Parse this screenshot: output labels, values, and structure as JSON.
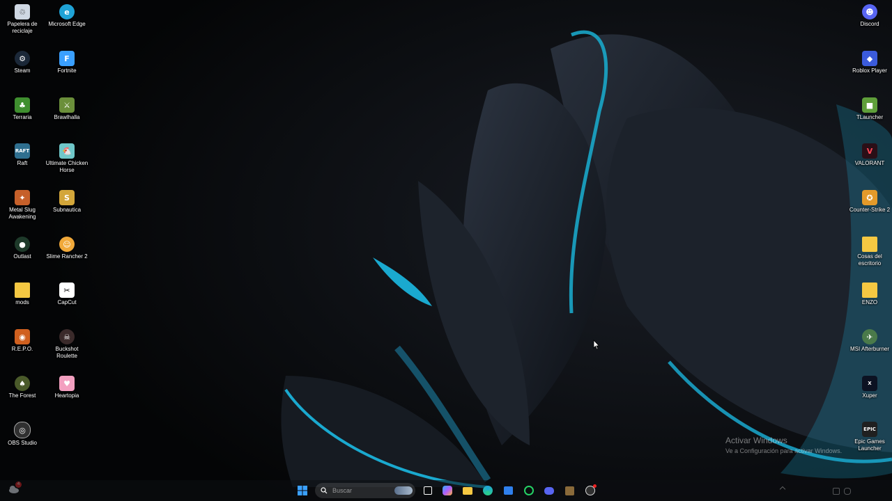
{
  "desktop": {
    "left_icons": [
      {
        "label": "Papelera de reciclaje",
        "icon": "recycle-bin-icon",
        "color": "#cfd8e3"
      },
      {
        "label": "Microsoft Edge",
        "icon": "edge-icon",
        "color": "#1fa3d6"
      },
      {
        "label": "Steam",
        "icon": "steam-icon",
        "color": "#1b2838"
      },
      {
        "label": "Fortnite",
        "icon": "fortnite-icon",
        "color": "#3aa0ff"
      },
      {
        "label": "Terraria",
        "icon": "terraria-icon",
        "color": "#3f8f2f"
      },
      {
        "label": "Brawlhalla",
        "icon": "brawlhalla-icon",
        "color": "#6b8f3a"
      },
      {
        "label": "Raft",
        "icon": "raft-icon",
        "color": "#2f6f8f"
      },
      {
        "label": "Ultimate Chicken Horse",
        "icon": "chicken-horse-icon",
        "color": "#6fc7c9"
      },
      {
        "label": "Metal Slug Awakening",
        "icon": "metal-slug-icon",
        "color": "#c6602a"
      },
      {
        "label": "Subnautica",
        "icon": "subnautica-icon",
        "color": "#d3a63a"
      },
      {
        "label": "Outlast",
        "icon": "outlast-icon",
        "color": "#1e3a2a"
      },
      {
        "label": "Slime Rancher 2",
        "icon": "slime-rancher-icon",
        "color": "#f1a93a"
      },
      {
        "label": "mods",
        "icon": "folder-icon",
        "color": "#f5c842"
      },
      {
        "label": "CapCut",
        "icon": "capcut-icon",
        "color": "#ffffff"
      },
      {
        "label": "R.E.P.O.",
        "icon": "repo-icon",
        "color": "#d0601f"
      },
      {
        "label": "Buckshot Roulette",
        "icon": "buckshot-roulette-icon",
        "color": "#3a2a2a"
      },
      {
        "label": "The Forest",
        "icon": "the-forest-icon",
        "color": "#4a5a2a"
      },
      {
        "label": "Heartopia",
        "icon": "heartopia-icon",
        "color": "#f3a0c0"
      },
      {
        "label": "OBS Studio",
        "icon": "obs-icon",
        "color": "#303030"
      }
    ],
    "right_icons": [
      {
        "label": "Discord",
        "icon": "discord-icon",
        "color": "#5865f2"
      },
      {
        "label": "Roblox Player",
        "icon": "roblox-icon",
        "color": "#3b5bdb"
      },
      {
        "label": "TLauncher",
        "icon": "tlauncher-icon",
        "color": "#5f9f3a"
      },
      {
        "label": "VALORANT",
        "icon": "valorant-icon",
        "color": "#2a0f17"
      },
      {
        "label": "Counter-Strike 2",
        "icon": "counter-strike-icon",
        "color": "#e39a2a"
      },
      {
        "label": "Cosas del escritorio",
        "icon": "folder-icon",
        "color": "#f5c842"
      },
      {
        "label": "ENZO",
        "icon": "folder-icon",
        "color": "#f5c842"
      },
      {
        "label": "MSI Afterburner",
        "icon": "msi-afterburner-icon",
        "color": "#4a7a4a"
      },
      {
        "label": "Xuper",
        "icon": "xuper-icon",
        "color": "#0c1222"
      },
      {
        "label": "Epic Games Launcher",
        "icon": "epic-games-icon",
        "color": "#202020"
      }
    ]
  },
  "watermark": {
    "line1": "Activar Windows",
    "line2": "Ve a Configuración para activar Windows."
  },
  "taskbar": {
    "search_placeholder": "Buscar",
    "widgets_badge": "4",
    "apps": [
      {
        "icon": "start-icon",
        "color": "#3aa0ff"
      },
      {
        "icon": "task-view-icon",
        "color": "#ffffff"
      },
      {
        "icon": "copilot-icon",
        "color": "#6ad0ff"
      },
      {
        "icon": "file-explorer-icon",
        "color": "#f5c842"
      },
      {
        "icon": "edge-icon",
        "color": "#1fa3d6"
      },
      {
        "icon": "microsoft-store-icon",
        "color": "#2f80ed"
      },
      {
        "icon": "whatsapp-icon",
        "color": "#25d366"
      },
      {
        "icon": "discord-icon",
        "color": "#5865f2"
      },
      {
        "icon": "winrar-icon",
        "color": "#8a6a3a"
      },
      {
        "icon": "obs-icon",
        "color": "#303030"
      }
    ]
  },
  "accent": "#19a6c8"
}
